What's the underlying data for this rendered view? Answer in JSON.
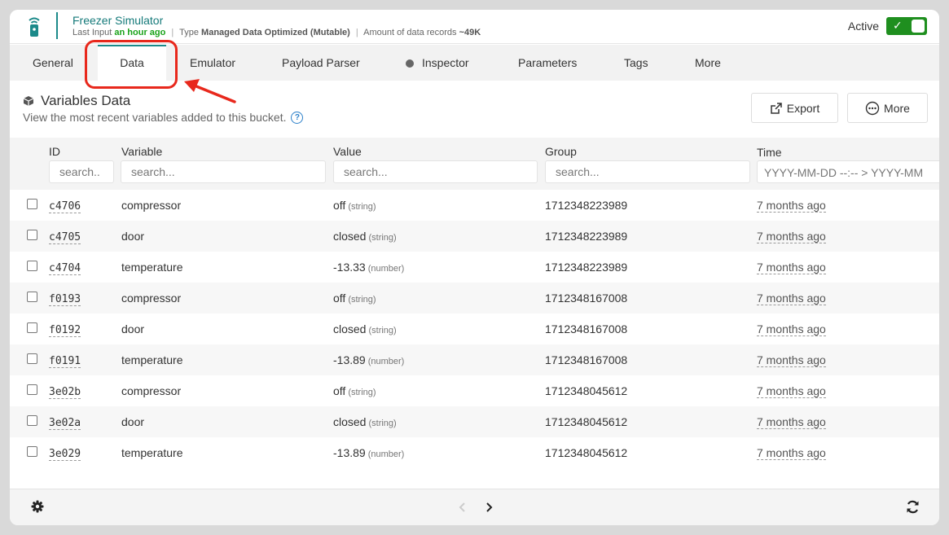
{
  "header": {
    "title": "Freezer Simulator",
    "last_input_label": "Last Input",
    "last_input_value": "an hour ago",
    "type_label": "Type",
    "type_value": "Managed Data Optimized (Mutable)",
    "records_label": "Amount of data records",
    "records_value": "~49K",
    "active_label": "Active",
    "active_on": true
  },
  "tabs": [
    {
      "label": "General"
    },
    {
      "label": "Data",
      "active": true
    },
    {
      "label": "Emulator"
    },
    {
      "label": "Payload Parser"
    },
    {
      "label": "Inspector"
    },
    {
      "label": "Parameters"
    },
    {
      "label": "Tags"
    },
    {
      "label": "More"
    }
  ],
  "section": {
    "title": "Variables Data",
    "subtitle": "View the most recent variables added to this bucket.",
    "export_label": "Export",
    "more_label": "More"
  },
  "table": {
    "columns": {
      "id": "ID",
      "variable": "Variable",
      "value": "Value",
      "group": "Group",
      "time": "Time"
    },
    "filters": {
      "id_placeholder": "search..",
      "variable_placeholder": "search...",
      "value_placeholder": "search...",
      "group_placeholder": "search...",
      "time_placeholder": "YYYY-MM-DD --:-- > YYYY-MM"
    },
    "rows": [
      {
        "id": "c4706",
        "variable": "compressor",
        "value": "off",
        "type": "(string)",
        "group": "1712348223989",
        "time": "7 months ago"
      },
      {
        "id": "c4705",
        "variable": "door",
        "value": "closed",
        "type": "(string)",
        "group": "1712348223989",
        "time": "7 months ago"
      },
      {
        "id": "c4704",
        "variable": "temperature",
        "value": "-13.33",
        "type": "(number)",
        "group": "1712348223989",
        "time": "7 months ago"
      },
      {
        "id": "f0193",
        "variable": "compressor",
        "value": "off",
        "type": "(string)",
        "group": "1712348167008",
        "time": "7 months ago"
      },
      {
        "id": "f0192",
        "variable": "door",
        "value": "closed",
        "type": "(string)",
        "group": "1712348167008",
        "time": "7 months ago"
      },
      {
        "id": "f0191",
        "variable": "temperature",
        "value": "-13.89",
        "type": "(number)",
        "group": "1712348167008",
        "time": "7 months ago"
      },
      {
        "id": "3e02b",
        "variable": "compressor",
        "value": "off",
        "type": "(string)",
        "group": "1712348045612",
        "time": "7 months ago"
      },
      {
        "id": "3e02a",
        "variable": "door",
        "value": "closed",
        "type": "(string)",
        "group": "1712348045612",
        "time": "7 months ago"
      },
      {
        "id": "3e029",
        "variable": "temperature",
        "value": "-13.89",
        "type": "(number)",
        "group": "1712348045612",
        "time": "7 months ago"
      }
    ]
  },
  "colors": {
    "accent": "#1c8a8a",
    "active_green": "#1f8f1f",
    "highlight_red": "#e8281c"
  }
}
